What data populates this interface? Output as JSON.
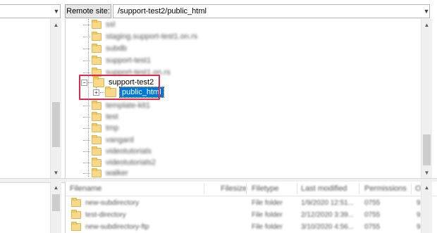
{
  "remote": {
    "label": "Remote site:",
    "path": "/support-test2/public_html"
  },
  "tree": {
    "blurred_before": [
      "ssl",
      "staging.support-test1.on.rs",
      "subdb",
      "support-test1",
      "support-test1.on.rs"
    ],
    "expanded_folder": "support-test2",
    "selected_child": "public_html",
    "blurred_after": [
      "template-kit1",
      "test",
      "tmp",
      "vangard",
      "videotutorials",
      "videotutorials2",
      "walker"
    ]
  },
  "file_list": {
    "columns": [
      "Filename",
      "Filesize",
      "Filetype",
      "Last modified",
      "Permissions",
      "O"
    ],
    "rows": [
      {
        "name": "new-subdirectory",
        "type": "File folder",
        "modified": "1/9/2020 12:51...",
        "perms": "0755",
        "owner": "9"
      },
      {
        "name": "test-directory",
        "type": "File folder",
        "modified": "2/12/2020 3:39...",
        "perms": "0755",
        "owner": "9"
      },
      {
        "name": "new-subdirectory-ftp",
        "type": "File folder",
        "modified": "3/10/2020 4:56...",
        "perms": "0755",
        "owner": "9"
      }
    ]
  },
  "icons": {
    "dropdown": "chevron-down-icon",
    "scroll_up": "arrow-up-icon",
    "scroll_down": "arrow-down-icon",
    "folder": "folder-icon",
    "expander": "plus-box-icon",
    "collapser": "minus-box-icon"
  },
  "colors": {
    "selection": "#0078d7",
    "highlight": "#e0284f",
    "folder": "#f7d98b"
  }
}
